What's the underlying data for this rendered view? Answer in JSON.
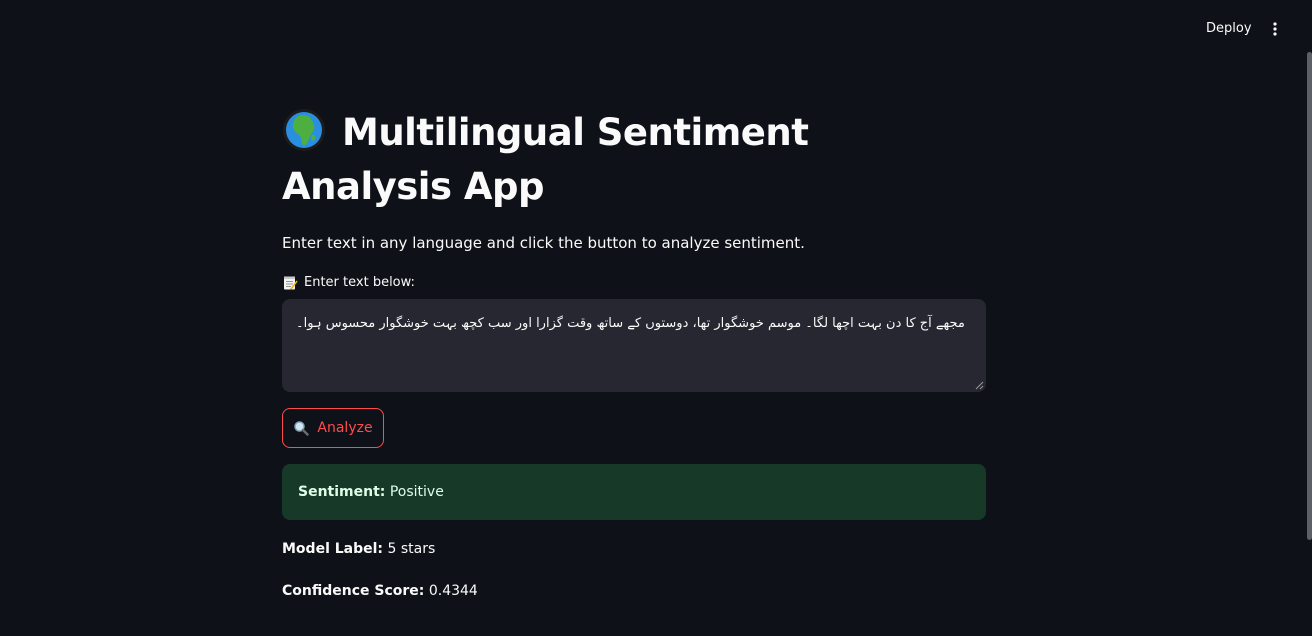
{
  "header": {
    "deploy_label": "Deploy",
    "menu_icon": "more-vertical-icon"
  },
  "page": {
    "title_icon": "globe-africa-icon",
    "title": "Multilingual Sentiment Analysis App",
    "subtitle": "Enter text in any language and click the button to analyze sentiment."
  },
  "input": {
    "label_icon": "memo-icon",
    "label": "Enter text below:",
    "value": "مجھے آج کا دن بہت اچھا لگا۔ موسم خوشگوار تھا، دوستوں کے ساتھ وقت گزارا اور سب کچھ بہت خوشگوار محسوس ہوا۔"
  },
  "analyze_button": {
    "icon": "magnifying-glass-icon",
    "label": "Analyze"
  },
  "result": {
    "sentiment_label": "Sentiment:",
    "sentiment_value": "Positive",
    "model_label_label": "Model Label:",
    "model_label_value": "5 stars",
    "confidence_label": "Confidence Score:",
    "confidence_value": "0.4344"
  },
  "colors": {
    "background": "#0e1117",
    "input_background": "#262730",
    "accent": "#ff4b4b",
    "success_background": "#173928",
    "success_text": "#dffde9"
  }
}
